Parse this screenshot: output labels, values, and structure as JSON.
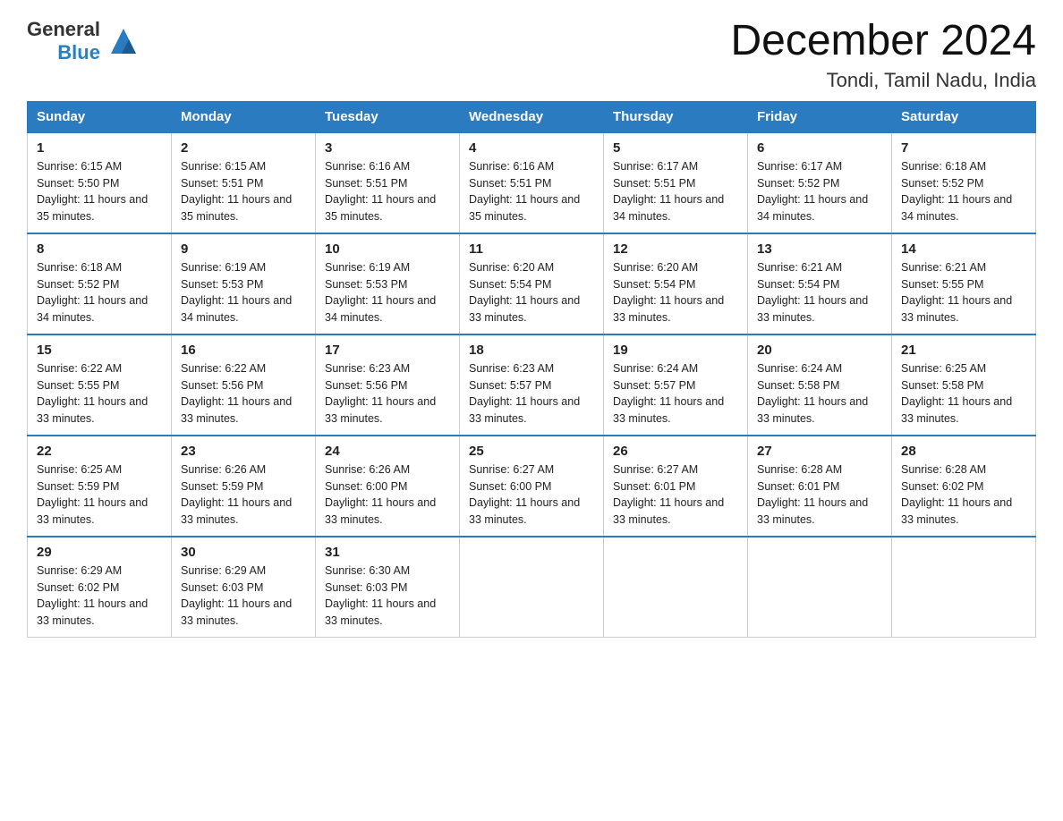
{
  "header": {
    "logo_general": "General",
    "logo_blue": "Blue",
    "month_title": "December 2024",
    "location": "Tondi, Tamil Nadu, India"
  },
  "days_of_week": [
    "Sunday",
    "Monday",
    "Tuesday",
    "Wednesday",
    "Thursday",
    "Friday",
    "Saturday"
  ],
  "weeks": [
    [
      {
        "day": "1",
        "sunrise": "6:15 AM",
        "sunset": "5:50 PM",
        "daylight": "11 hours and 35 minutes."
      },
      {
        "day": "2",
        "sunrise": "6:15 AM",
        "sunset": "5:51 PM",
        "daylight": "11 hours and 35 minutes."
      },
      {
        "day": "3",
        "sunrise": "6:16 AM",
        "sunset": "5:51 PM",
        "daylight": "11 hours and 35 minutes."
      },
      {
        "day": "4",
        "sunrise": "6:16 AM",
        "sunset": "5:51 PM",
        "daylight": "11 hours and 35 minutes."
      },
      {
        "day": "5",
        "sunrise": "6:17 AM",
        "sunset": "5:51 PM",
        "daylight": "11 hours and 34 minutes."
      },
      {
        "day": "6",
        "sunrise": "6:17 AM",
        "sunset": "5:52 PM",
        "daylight": "11 hours and 34 minutes."
      },
      {
        "day": "7",
        "sunrise": "6:18 AM",
        "sunset": "5:52 PM",
        "daylight": "11 hours and 34 minutes."
      }
    ],
    [
      {
        "day": "8",
        "sunrise": "6:18 AM",
        "sunset": "5:52 PM",
        "daylight": "11 hours and 34 minutes."
      },
      {
        "day": "9",
        "sunrise": "6:19 AM",
        "sunset": "5:53 PM",
        "daylight": "11 hours and 34 minutes."
      },
      {
        "day": "10",
        "sunrise": "6:19 AM",
        "sunset": "5:53 PM",
        "daylight": "11 hours and 34 minutes."
      },
      {
        "day": "11",
        "sunrise": "6:20 AM",
        "sunset": "5:54 PM",
        "daylight": "11 hours and 33 minutes."
      },
      {
        "day": "12",
        "sunrise": "6:20 AM",
        "sunset": "5:54 PM",
        "daylight": "11 hours and 33 minutes."
      },
      {
        "day": "13",
        "sunrise": "6:21 AM",
        "sunset": "5:54 PM",
        "daylight": "11 hours and 33 minutes."
      },
      {
        "day": "14",
        "sunrise": "6:21 AM",
        "sunset": "5:55 PM",
        "daylight": "11 hours and 33 minutes."
      }
    ],
    [
      {
        "day": "15",
        "sunrise": "6:22 AM",
        "sunset": "5:55 PM",
        "daylight": "11 hours and 33 minutes."
      },
      {
        "day": "16",
        "sunrise": "6:22 AM",
        "sunset": "5:56 PM",
        "daylight": "11 hours and 33 minutes."
      },
      {
        "day": "17",
        "sunrise": "6:23 AM",
        "sunset": "5:56 PM",
        "daylight": "11 hours and 33 minutes."
      },
      {
        "day": "18",
        "sunrise": "6:23 AM",
        "sunset": "5:57 PM",
        "daylight": "11 hours and 33 minutes."
      },
      {
        "day": "19",
        "sunrise": "6:24 AM",
        "sunset": "5:57 PM",
        "daylight": "11 hours and 33 minutes."
      },
      {
        "day": "20",
        "sunrise": "6:24 AM",
        "sunset": "5:58 PM",
        "daylight": "11 hours and 33 minutes."
      },
      {
        "day": "21",
        "sunrise": "6:25 AM",
        "sunset": "5:58 PM",
        "daylight": "11 hours and 33 minutes."
      }
    ],
    [
      {
        "day": "22",
        "sunrise": "6:25 AM",
        "sunset": "5:59 PM",
        "daylight": "11 hours and 33 minutes."
      },
      {
        "day": "23",
        "sunrise": "6:26 AM",
        "sunset": "5:59 PM",
        "daylight": "11 hours and 33 minutes."
      },
      {
        "day": "24",
        "sunrise": "6:26 AM",
        "sunset": "6:00 PM",
        "daylight": "11 hours and 33 minutes."
      },
      {
        "day": "25",
        "sunrise": "6:27 AM",
        "sunset": "6:00 PM",
        "daylight": "11 hours and 33 minutes."
      },
      {
        "day": "26",
        "sunrise": "6:27 AM",
        "sunset": "6:01 PM",
        "daylight": "11 hours and 33 minutes."
      },
      {
        "day": "27",
        "sunrise": "6:28 AM",
        "sunset": "6:01 PM",
        "daylight": "11 hours and 33 minutes."
      },
      {
        "day": "28",
        "sunrise": "6:28 AM",
        "sunset": "6:02 PM",
        "daylight": "11 hours and 33 minutes."
      }
    ],
    [
      {
        "day": "29",
        "sunrise": "6:29 AM",
        "sunset": "6:02 PM",
        "daylight": "11 hours and 33 minutes."
      },
      {
        "day": "30",
        "sunrise": "6:29 AM",
        "sunset": "6:03 PM",
        "daylight": "11 hours and 33 minutes."
      },
      {
        "day": "31",
        "sunrise": "6:30 AM",
        "sunset": "6:03 PM",
        "daylight": "11 hours and 33 minutes."
      },
      null,
      null,
      null,
      null
    ]
  ]
}
